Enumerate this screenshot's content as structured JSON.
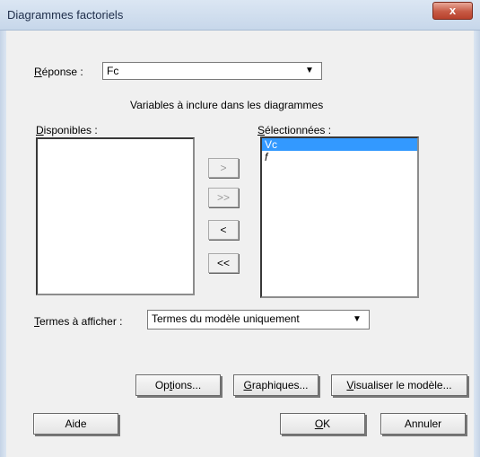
{
  "window": {
    "title": "Diagrammes factoriels",
    "close_label": "x"
  },
  "response": {
    "label_prefix": "",
    "label_mnemonic": "R",
    "label_rest": "éponse :",
    "value": "Fc"
  },
  "variables_heading": "Variables à inclure dans les diagrammes",
  "available": {
    "label_mnemonic": "D",
    "label_rest": "isponibles :",
    "items": []
  },
  "selected": {
    "label_mnemonic": "S",
    "label_rest": "électionnées :",
    "items": [
      {
        "text": "Vc",
        "selected": true
      },
      {
        "text": "f",
        "selected": false
      }
    ]
  },
  "move_buttons": {
    "add": ">",
    "add_all": ">>",
    "remove": "<",
    "remove_all": "<<"
  },
  "terms": {
    "label_mnemonic": "T",
    "label_rest": "ermes à afficher :",
    "value": "Termes du modèle uniquement"
  },
  "buttons": {
    "options": {
      "before": "Op",
      "mnemonic": "t",
      "after": "ions..."
    },
    "graphiques": {
      "before": "",
      "mnemonic": "G",
      "after": "raphiques..."
    },
    "visualiser": {
      "before": "",
      "mnemonic": "V",
      "after": "isualiser le modèle..."
    },
    "aide": "Aide",
    "ok": {
      "before": "",
      "mnemonic": "O",
      "after": "K"
    },
    "annuler": "Annuler"
  }
}
